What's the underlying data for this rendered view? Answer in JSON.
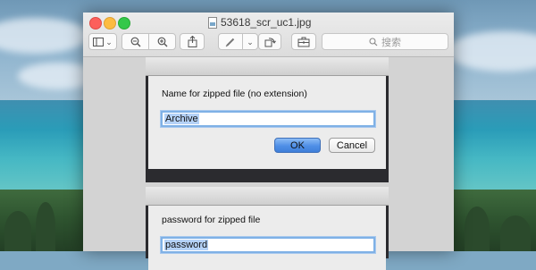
{
  "window": {
    "title": "53618_scr_uc1.jpg"
  },
  "toolbar": {
    "sidebar_chevron": "⌄",
    "zoom_out": "−",
    "zoom_in": "+",
    "share": "↑",
    "markup_chevron": "⌄",
    "search_placeholder": "搜索"
  },
  "dialog_zip_name": {
    "prompt": "Name for zipped file (no extension)",
    "value": "Archive",
    "ok_label": "OK",
    "cancel_label": "Cancel"
  },
  "dialog_password": {
    "prompt": "password for zipped file",
    "value": "password"
  },
  "colors": {
    "accent": "#4f8fe6",
    "focus_ring": "#7fb1e6",
    "close": "#fc605b",
    "minimize": "#fdbc40",
    "maximize": "#34c84a"
  },
  "icons": {
    "sidebar": "sidebar-icon",
    "zoom_out": "zoom-out-icon",
    "zoom_in": "zoom-in-icon",
    "share": "share-icon",
    "markup": "pen-icon",
    "rotate": "rotate-icon",
    "toolbox": "toolbox-icon",
    "search": "search-icon",
    "document": "document-icon"
  }
}
